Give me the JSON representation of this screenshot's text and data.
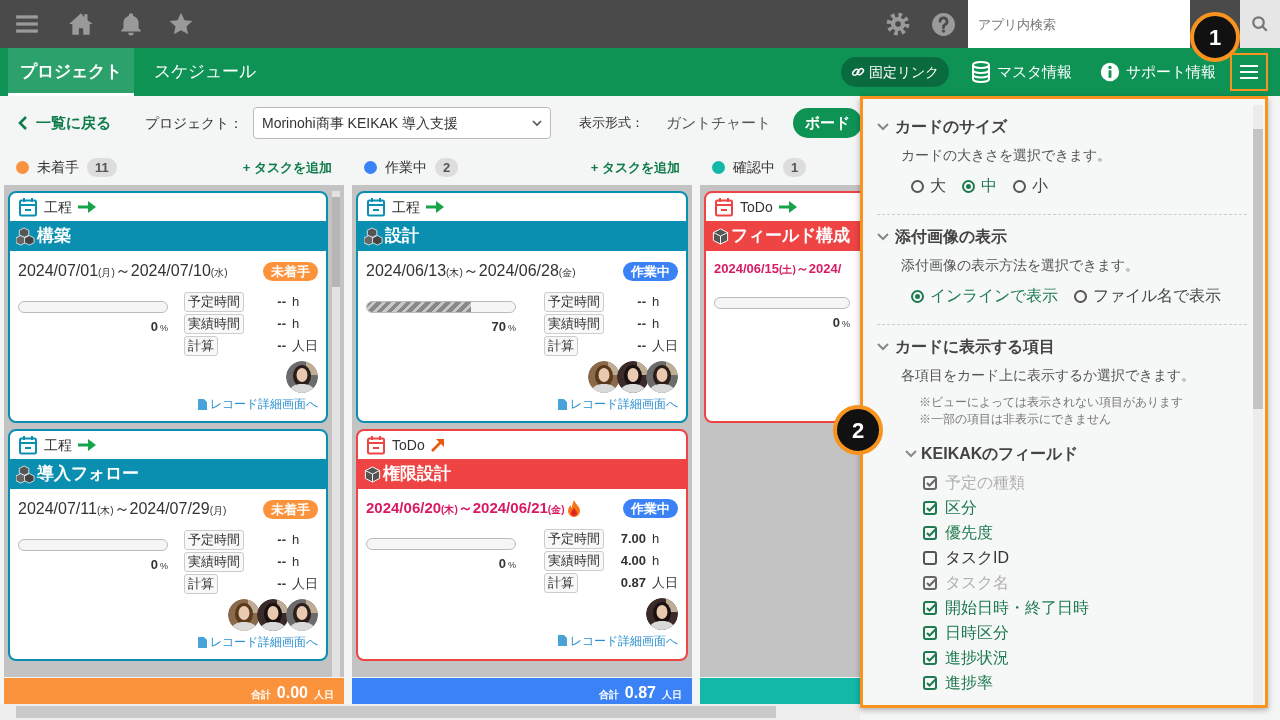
{
  "topbar": {
    "search": {
      "placeholder": "アプリ内検索"
    }
  },
  "tabs": [
    {
      "label": "プロジェクト",
      "selected": true
    },
    {
      "label": "スケジュール",
      "selected": false
    }
  ],
  "header_links": [
    {
      "kind": "pill",
      "label": "固定リンク"
    },
    {
      "kind": "database",
      "label": "マスタ情報"
    },
    {
      "kind": "info",
      "label": "サポート情報"
    }
  ],
  "back_link": "一覧に戻る",
  "project": {
    "label": "プロジェクト：",
    "value": "Morinohi商事 KEIKAK 導入支援"
  },
  "view": {
    "label": "表示形式：",
    "options": [
      {
        "label": "ガントチャート",
        "selected": false
      },
      {
        "label": "ボード",
        "selected": true
      }
    ]
  },
  "columns": [
    {
      "name": "未着手",
      "color": "#fb923c",
      "count": "11",
      "add_label": "+ タスクを追加",
      "cards": [
        {
          "type": "工程",
          "kind": "process",
          "rising": false,
          "title": "構築",
          "dates": {
            "start": "2024/07/01",
            "start_dow": "(月)",
            "separator": "～",
            "end": "2024/07/10",
            "end_dow": "(水)"
          },
          "overdue": false,
          "urgent": false,
          "status": {
            "label": "未着手",
            "color": "#fb923c"
          },
          "level": 0,
          "percent": "0",
          "percent_unit": "%",
          "metrics": [
            {
              "label": "予定時間",
              "value": "--",
              "unit": "h"
            },
            {
              "label": "実績時間",
              "value": "--",
              "unit": "h"
            },
            {
              "label": "計算",
              "value": "--",
              "unit": "人日"
            }
          ],
          "assignees": [
            {
              "kind": "picture"
            }
          ],
          "link": "レコード詳細画面へ"
        },
        {
          "type": "工程",
          "kind": "process",
          "rising": false,
          "title": "導入フォロー",
          "dates": {
            "start": "2024/07/11",
            "start_dow": "(木)",
            "separator": "～",
            "end": "2024/07/29",
            "end_dow": "(月)"
          },
          "overdue": false,
          "urgent": false,
          "status": {
            "label": "未着手",
            "color": "#fb923c"
          },
          "level": 0,
          "percent": "0",
          "percent_unit": "%",
          "metrics": [
            {
              "label": "予定時間",
              "value": "--",
              "unit": "h"
            },
            {
              "label": "実績時間",
              "value": "--",
              "unit": "h"
            },
            {
              "label": "計算",
              "value": "--",
              "unit": "人日"
            }
          ],
          "assignees": [
            {
              "kind": "picture"
            },
            {
              "kind": "picture"
            },
            {
              "kind": "picture"
            }
          ],
          "link": "レコード詳細画面へ"
        }
      ],
      "total": {
        "label": "合計",
        "value": "0.00",
        "unit": "人日"
      }
    },
    {
      "name": "作業中",
      "color": "#3b82f6",
      "count": "2",
      "add_label": "+ タスクを追加",
      "cards": [
        {
          "type": "工程",
          "kind": "process",
          "rising": false,
          "title": "設計",
          "dates": {
            "start": "2024/06/13",
            "start_dow": "(木)",
            "separator": "～",
            "end": "2024/06/28",
            "end_dow": "(金)"
          },
          "overdue": false,
          "urgent": false,
          "status": {
            "label": "作業中",
            "color": "#3b82f6"
          },
          "level": 0.7,
          "percent": "70",
          "percent_unit": "%",
          "metrics": [
            {
              "label": "予定時間",
              "value": "--",
              "unit": "h"
            },
            {
              "label": "実績時間",
              "value": "--",
              "unit": "h"
            },
            {
              "label": "計算",
              "value": "--",
              "unit": "人日"
            }
          ],
          "assignees": [
            {
              "kind": "picture"
            },
            {
              "kind": "picture"
            },
            {
              "kind": "picture"
            }
          ],
          "link": "レコード詳細画面へ"
        },
        {
          "type": "ToDo",
          "kind": "todo",
          "rising": true,
          "title": "権限設計",
          "dates": {
            "start": "2024/06/20",
            "start_dow": "(木)",
            "separator": "～",
            "end": "2024/06/21",
            "end_dow": "(金)"
          },
          "overdue": true,
          "urgent": true,
          "status": {
            "label": "作業中",
            "color": "#3b82f6"
          },
          "level": 0,
          "percent": "0",
          "percent_unit": "%",
          "metrics": [
            {
              "label": "予定時間",
              "value": "7.00",
              "unit": "h"
            },
            {
              "label": "実績時間",
              "value": "4.00",
              "unit": "h"
            },
            {
              "label": "計算",
              "value": "0.87",
              "unit": "人日"
            }
          ],
          "assignees": [
            {
              "kind": "picture"
            }
          ],
          "link": "レコード詳細画面へ"
        }
      ],
      "total": {
        "label": "合計",
        "value": "0.87",
        "unit": "人日"
      }
    },
    {
      "name": "確認中",
      "color": "#14b8a6",
      "count": "1",
      "cards": [
        {
          "type": "ToDo",
          "kind": "todo",
          "rising": false,
          "title": "フィールド構成",
          "dates": {
            "start": "2024/06/15",
            "start_dow": "(土)",
            "separator": "～",
            "end": "2024/"
          },
          "overdue": true,
          "urgent": false,
          "level": 0,
          "percent": "0",
          "percent_unit": "%"
        }
      ]
    }
  ],
  "settings_panel": {
    "sections": [
      {
        "kind": "radio",
        "title": "カードのサイズ",
        "description": "カードの大きさを選択できます。",
        "options": [
          {
            "label": "大",
            "selected": false
          },
          {
            "label": "中",
            "selected": true
          },
          {
            "label": "小",
            "selected": false
          }
        ]
      },
      {
        "kind": "radio",
        "title": "添付画像の表示",
        "description": "添付画像の表示方法を選択できます。",
        "options": [
          {
            "label": "インラインで表示",
            "selected": true
          },
          {
            "label": "ファイル名で表示",
            "selected": false
          }
        ]
      },
      {
        "kind": "checklist",
        "title": "カードに表示する項目",
        "description": "各項目をカード上に表示するか選択できます。",
        "notes": [
          "※ビューによっては表示されない項目があります",
          "※一部の項目は非表示にできません"
        ],
        "groups": [
          {
            "title": "KEIKAKのフィールド",
            "items": [
              {
                "label": "予定の種類",
                "checked": true,
                "disabled": true
              },
              {
                "label": "区分",
                "checked": true,
                "disabled": false
              },
              {
                "label": "優先度",
                "checked": true,
                "disabled": false
              },
              {
                "label": "タスクID",
                "checked": false,
                "disabled": false
              },
              {
                "label": "タスク名",
                "checked": true,
                "disabled": true
              },
              {
                "label": "開始日時・終了日時",
                "checked": true,
                "disabled": false
              },
              {
                "label": "日時区分",
                "checked": true,
                "disabled": false
              },
              {
                "label": "進捗状況",
                "checked": true,
                "disabled": false
              },
              {
                "label": "進捗率",
                "checked": true,
                "disabled": false
              }
            ]
          }
        ]
      }
    ]
  },
  "callouts": [
    "1",
    "2"
  ]
}
